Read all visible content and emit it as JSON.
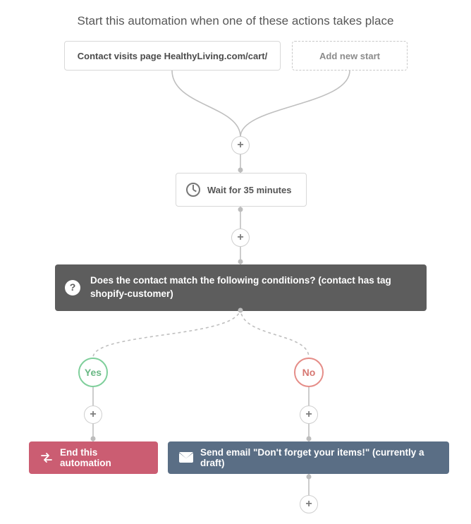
{
  "heading": "Start this automation when one of these actions takes place",
  "start": {
    "trigger_label": "Contact visits page HealthyLiving.com/cart/",
    "add_label": "Add new start"
  },
  "wait": {
    "label": "Wait for 35 minutes"
  },
  "condition": {
    "text": "Does the contact match the following conditions? (contact has tag shopify-customer)"
  },
  "branches": {
    "yes": "Yes",
    "no": "No"
  },
  "actions": {
    "end": "End this automation",
    "send": "Send email \"Don't forget your items!\" (currently a draft)"
  },
  "plus_glyph": "+",
  "help_glyph": "?"
}
